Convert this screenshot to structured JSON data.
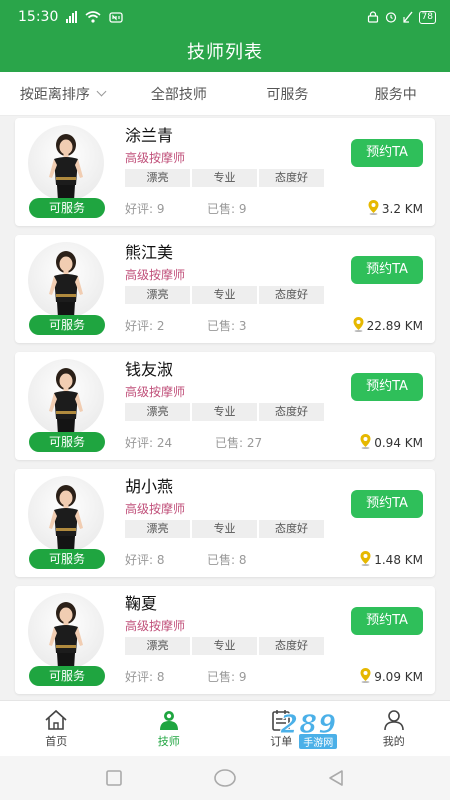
{
  "status_bar": {
    "time": "15:30",
    "network": "4G",
    "battery": "78"
  },
  "header": {
    "title": "技师列表"
  },
  "filters": [
    {
      "label": "按距离排序"
    },
    {
      "label": "全部技师"
    },
    {
      "label": "可服务"
    },
    {
      "label": "服务中"
    }
  ],
  "labels": {
    "good_review": "好评:",
    "sold": "已售:",
    "book_button": "预约TA"
  },
  "therapists": [
    {
      "name": "涂兰青",
      "level": "高级按摩师",
      "tags": [
        "漂亮",
        "专业",
        "态度好"
      ],
      "status": "可服务",
      "good_reviews": "9",
      "sold": "9",
      "distance": "3.2 KM"
    },
    {
      "name": "熊江美",
      "level": "高级按摩师",
      "tags": [
        "漂亮",
        "专业",
        "态度好"
      ],
      "status": "可服务",
      "good_reviews": "2",
      "sold": "3",
      "distance": "22.89 KM"
    },
    {
      "name": "钱友淑",
      "level": "高级按摩师",
      "tags": [
        "漂亮",
        "专业",
        "态度好"
      ],
      "status": "可服务",
      "good_reviews": "24",
      "sold": "27",
      "distance": "0.94 KM"
    },
    {
      "name": "胡小燕",
      "level": "高级按摩师",
      "tags": [
        "漂亮",
        "专业",
        "态度好"
      ],
      "status": "可服务",
      "good_reviews": "8",
      "sold": "8",
      "distance": "1.48 KM"
    },
    {
      "name": "鞠夏",
      "level": "高级按摩师",
      "tags": [
        "漂亮",
        "专业",
        "态度好"
      ],
      "status": "可服务",
      "good_reviews": "8",
      "sold": "9",
      "distance": "9.09 KM"
    }
  ],
  "tabbar": [
    {
      "label": "首页",
      "icon": "home-icon",
      "active": false
    },
    {
      "label": "技师",
      "icon": "technician-icon",
      "active": true
    },
    {
      "label": "订单",
      "icon": "order-icon",
      "active": false
    },
    {
      "label": "我的",
      "icon": "user-icon",
      "active": false
    }
  ],
  "watermark": {
    "number": "289",
    "text": "手游网"
  },
  "colors": {
    "brand_green": "#2aa54a",
    "button_green": "#2fbf5a",
    "level_pink": "#c0507a",
    "pin_yellow": "#e6b800"
  }
}
